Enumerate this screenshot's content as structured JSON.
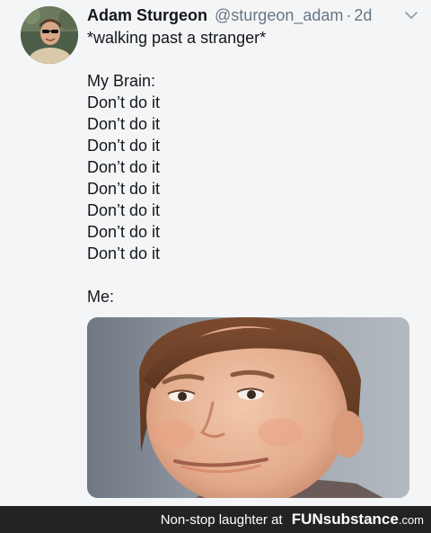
{
  "tweet": {
    "author_name": "Adam Sturgeon",
    "author_handle": "@sturgeon_adam",
    "separator": "·",
    "timestamp": "2d",
    "lines": [
      "*walking past a stranger*",
      "",
      "My Brain:",
      "Don’t do it",
      "Don’t do it",
      "Don’t do it",
      "Don’t do it",
      "Don’t do it",
      "Don’t do it",
      "Don’t do it",
      "Don’t do it",
      "",
      "Me:"
    ]
  },
  "footer": {
    "caption": "Non-stop laughter at",
    "brand_fun": "FUN",
    "brand_sub": "substance",
    "brand_tld": ".com"
  },
  "icons": {
    "menu": "chevron-down-icon",
    "avatar": "avatar",
    "media": "kid-smirk-photo"
  }
}
